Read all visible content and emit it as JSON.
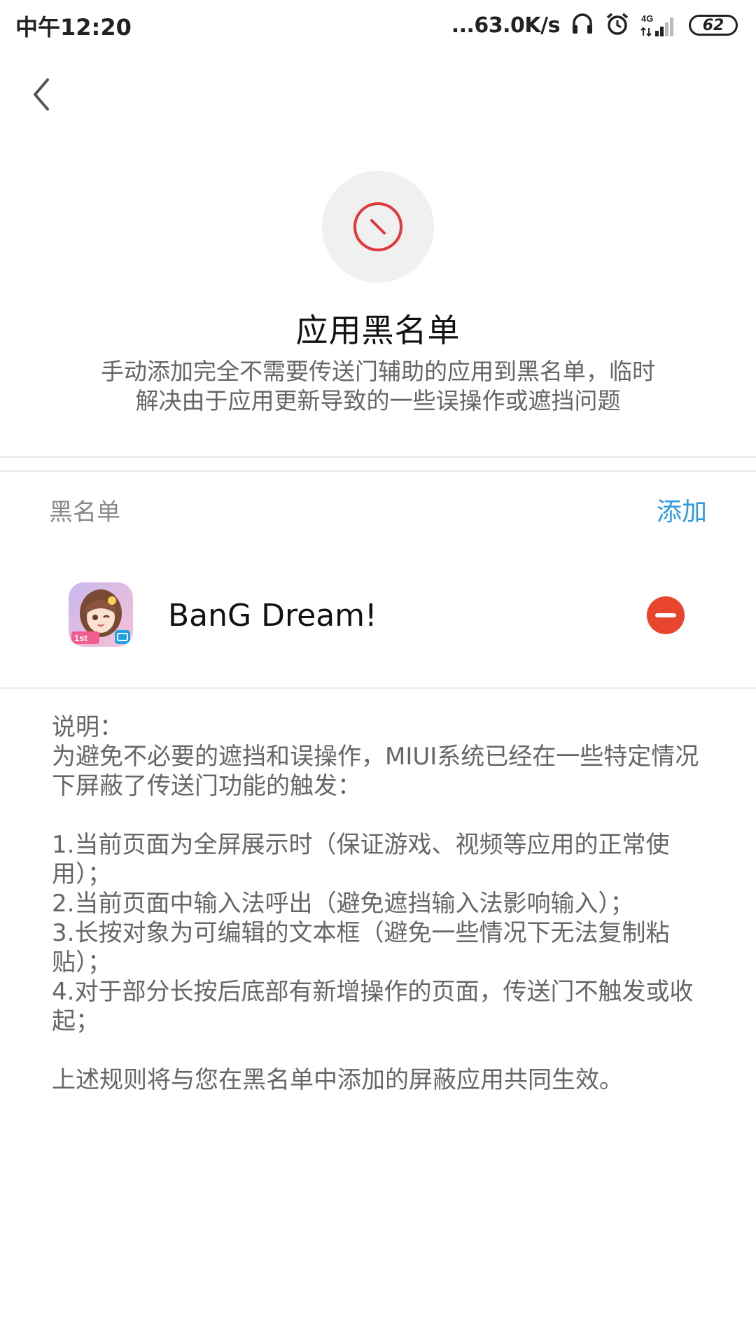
{
  "status_bar": {
    "time": "中午12:20",
    "net_speed": "...63.0K/s",
    "network_type": "4G",
    "battery_level": "62",
    "icons": [
      "headphones-icon",
      "alarm-icon",
      "signal-icon",
      "battery-icon"
    ]
  },
  "nav": {
    "back_icon": "chevron-left-icon"
  },
  "header": {
    "icon": "blocked-icon",
    "title": "应用黑名单",
    "description_line1": "手动添加完全不需要传送门辅助的应用到黑名单，临时",
    "description_line2": "解决由于应用更新导致的一些误操作或遮挡问题"
  },
  "blacklist": {
    "label": "黑名单",
    "add_label": "添加",
    "items": [
      {
        "name": "BanG Dream!",
        "icon": "bang-dream-app-icon",
        "action_icon": "remove-icon"
      }
    ]
  },
  "notes": {
    "heading": "说明：",
    "intro": "为避免不必要的遮挡和误操作，MIUI系统已经在一些特定情况下屏蔽了传送门功能的触发：",
    "rules": [
      "1.当前页面为全屏展示时（保证游戏、视频等应用的正常使用）；",
      "2.当前页面中输入法呼出（避免遮挡输入法影响输入）；",
      "3.长按对象为可编辑的文本框（避免一些情况下无法复制粘贴）；",
      "4.对于部分长按后底部有新增操作的页面，传送门不触发或收起；"
    ],
    "footer": "上述规则将与您在黑名单中添加的屏蔽应用共同生效。"
  },
  "colors": {
    "accent": "#2f9ae0",
    "danger": "#e8452e",
    "blocked_icon": "#e0393b"
  }
}
